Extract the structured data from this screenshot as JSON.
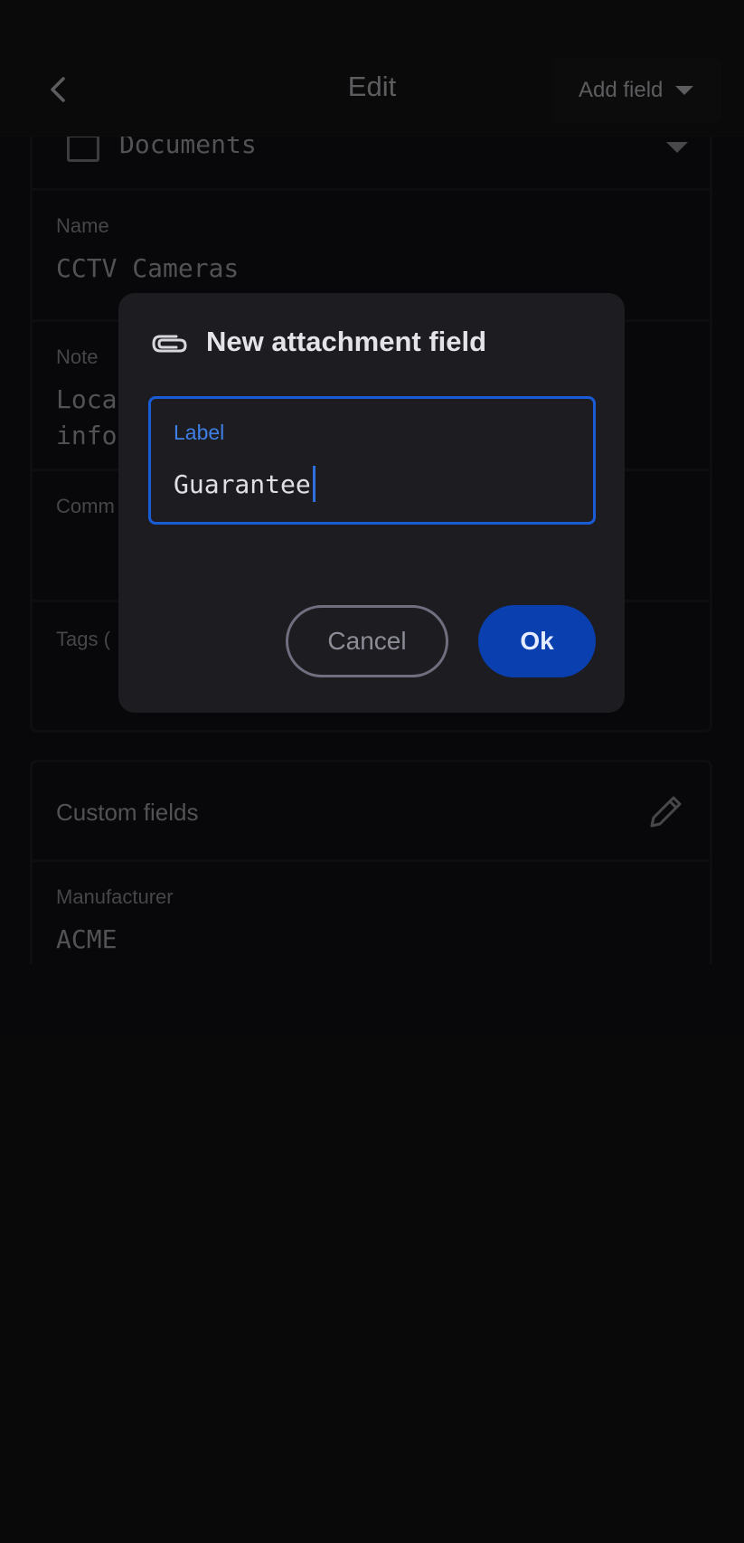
{
  "appbar": {
    "title": "Edit",
    "add_field_label": "Add field",
    "back_icon": "chevron-left-icon",
    "caret_icon": "caret-down-icon"
  },
  "main_card": {
    "vault": {
      "name": "Documents",
      "icon": "folder-icon",
      "caret_icon": "caret-down-icon"
    },
    "name": {
      "label": "Name",
      "value": "CCTV Cameras"
    },
    "note": {
      "label": "Note",
      "line1": "Loca",
      "line2": "info"
    },
    "comments": {
      "label": "Comm"
    },
    "tags": {
      "label": "Tags ("
    }
  },
  "custom_fields": {
    "title": "Custom fields",
    "edit_icon": "pencil-icon",
    "fields": [
      {
        "label": "Manufacturer",
        "value": "ACME"
      }
    ]
  },
  "dialog": {
    "icon": "paperclip-icon",
    "title": "New attachment field",
    "field_label": "Label",
    "field_value": "Guarantee",
    "cancel_label": "Cancel",
    "ok_label": "Ok"
  },
  "colors": {
    "accent": "#1a5bd6",
    "primary_button": "#0a3fb0",
    "dialog_bg": "#1d1d21",
    "page_bg": "#0d0d0f"
  }
}
